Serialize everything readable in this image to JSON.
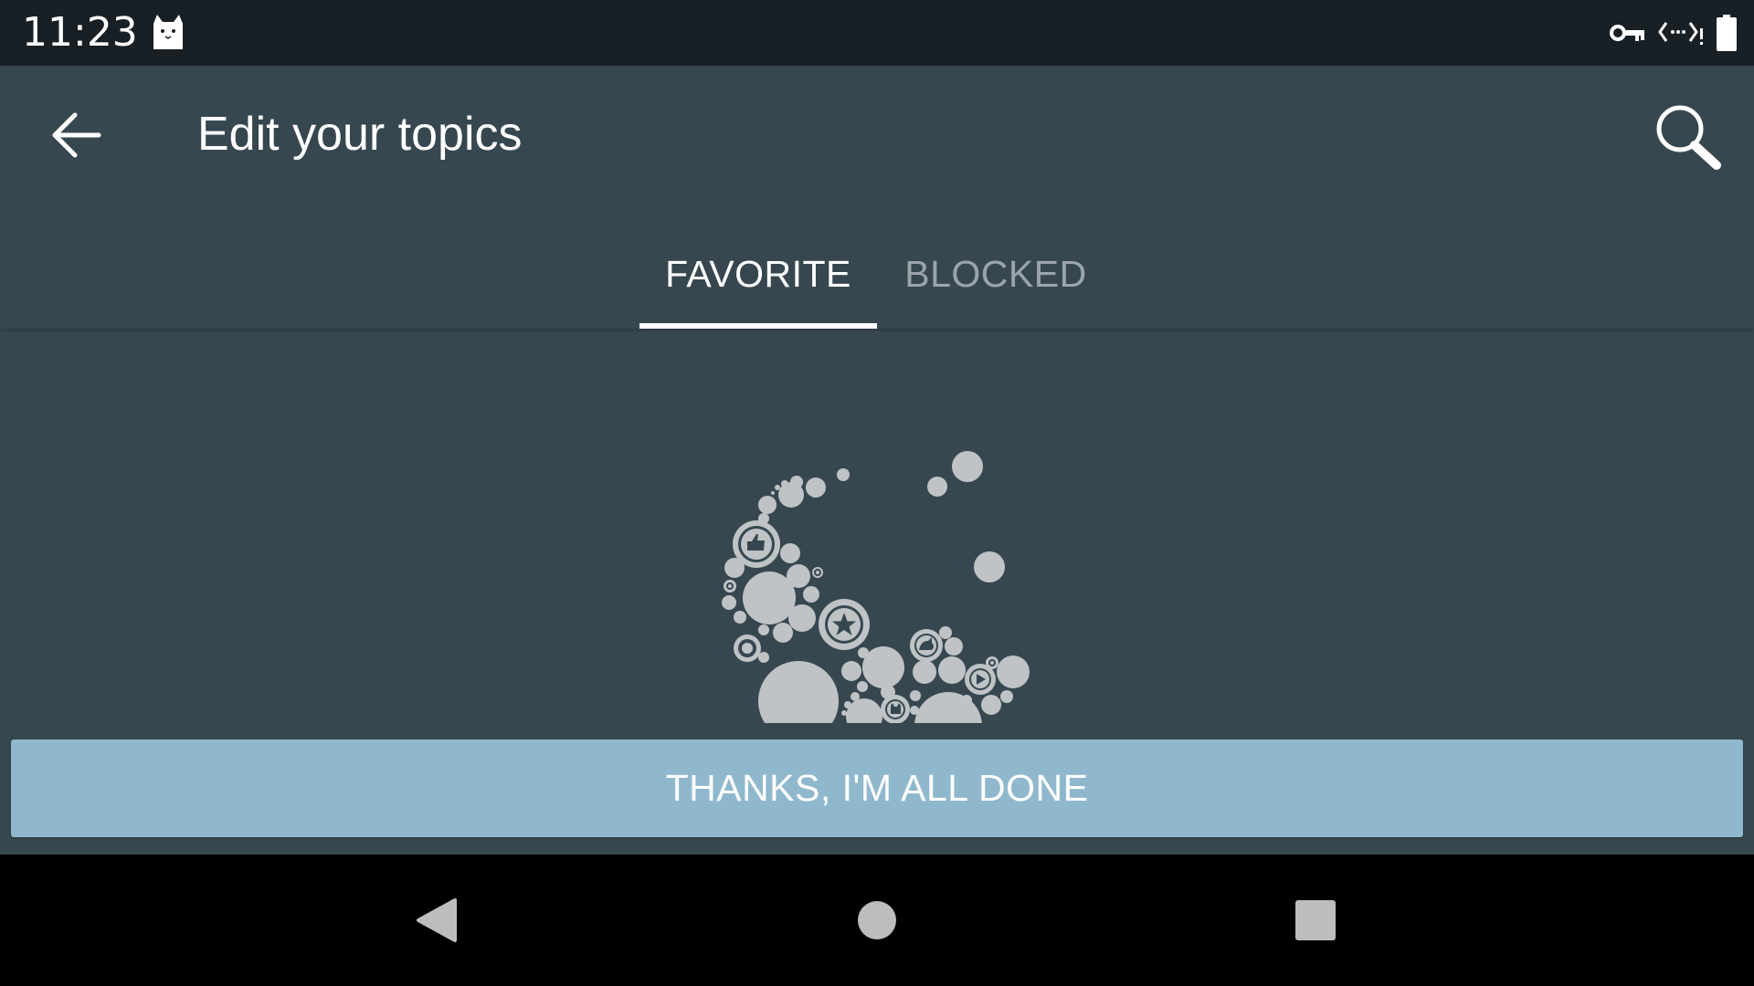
{
  "status_bar": {
    "time": "11:23",
    "icons": [
      "cat-notification-icon",
      "vpn-key-icon",
      "data-saver-icon",
      "battery-icon"
    ]
  },
  "app_bar": {
    "title": "Edit your topics",
    "back_icon": "arrow-back-icon",
    "search_icon": "search-icon"
  },
  "tabs": [
    {
      "label": "FAVORITE",
      "selected": true
    },
    {
      "label": "BLOCKED",
      "selected": false
    }
  ],
  "empty_state": {
    "illustration": "topic-bubbles-illustration"
  },
  "done_button": {
    "label": "THANKS, I'M ALL DONE"
  },
  "nav_bar": {
    "icons": [
      "nav-back-icon",
      "nav-home-icon",
      "nav-recents-icon"
    ]
  },
  "colors": {
    "status_bar": "#182026",
    "app_background": "#37474f",
    "tab_selected": "#ffffff",
    "tab_unselected": "#9aa5ab",
    "done_button": "#8fb8cd",
    "illustration": "#bfc3c6",
    "nav_bar": "#000000"
  }
}
